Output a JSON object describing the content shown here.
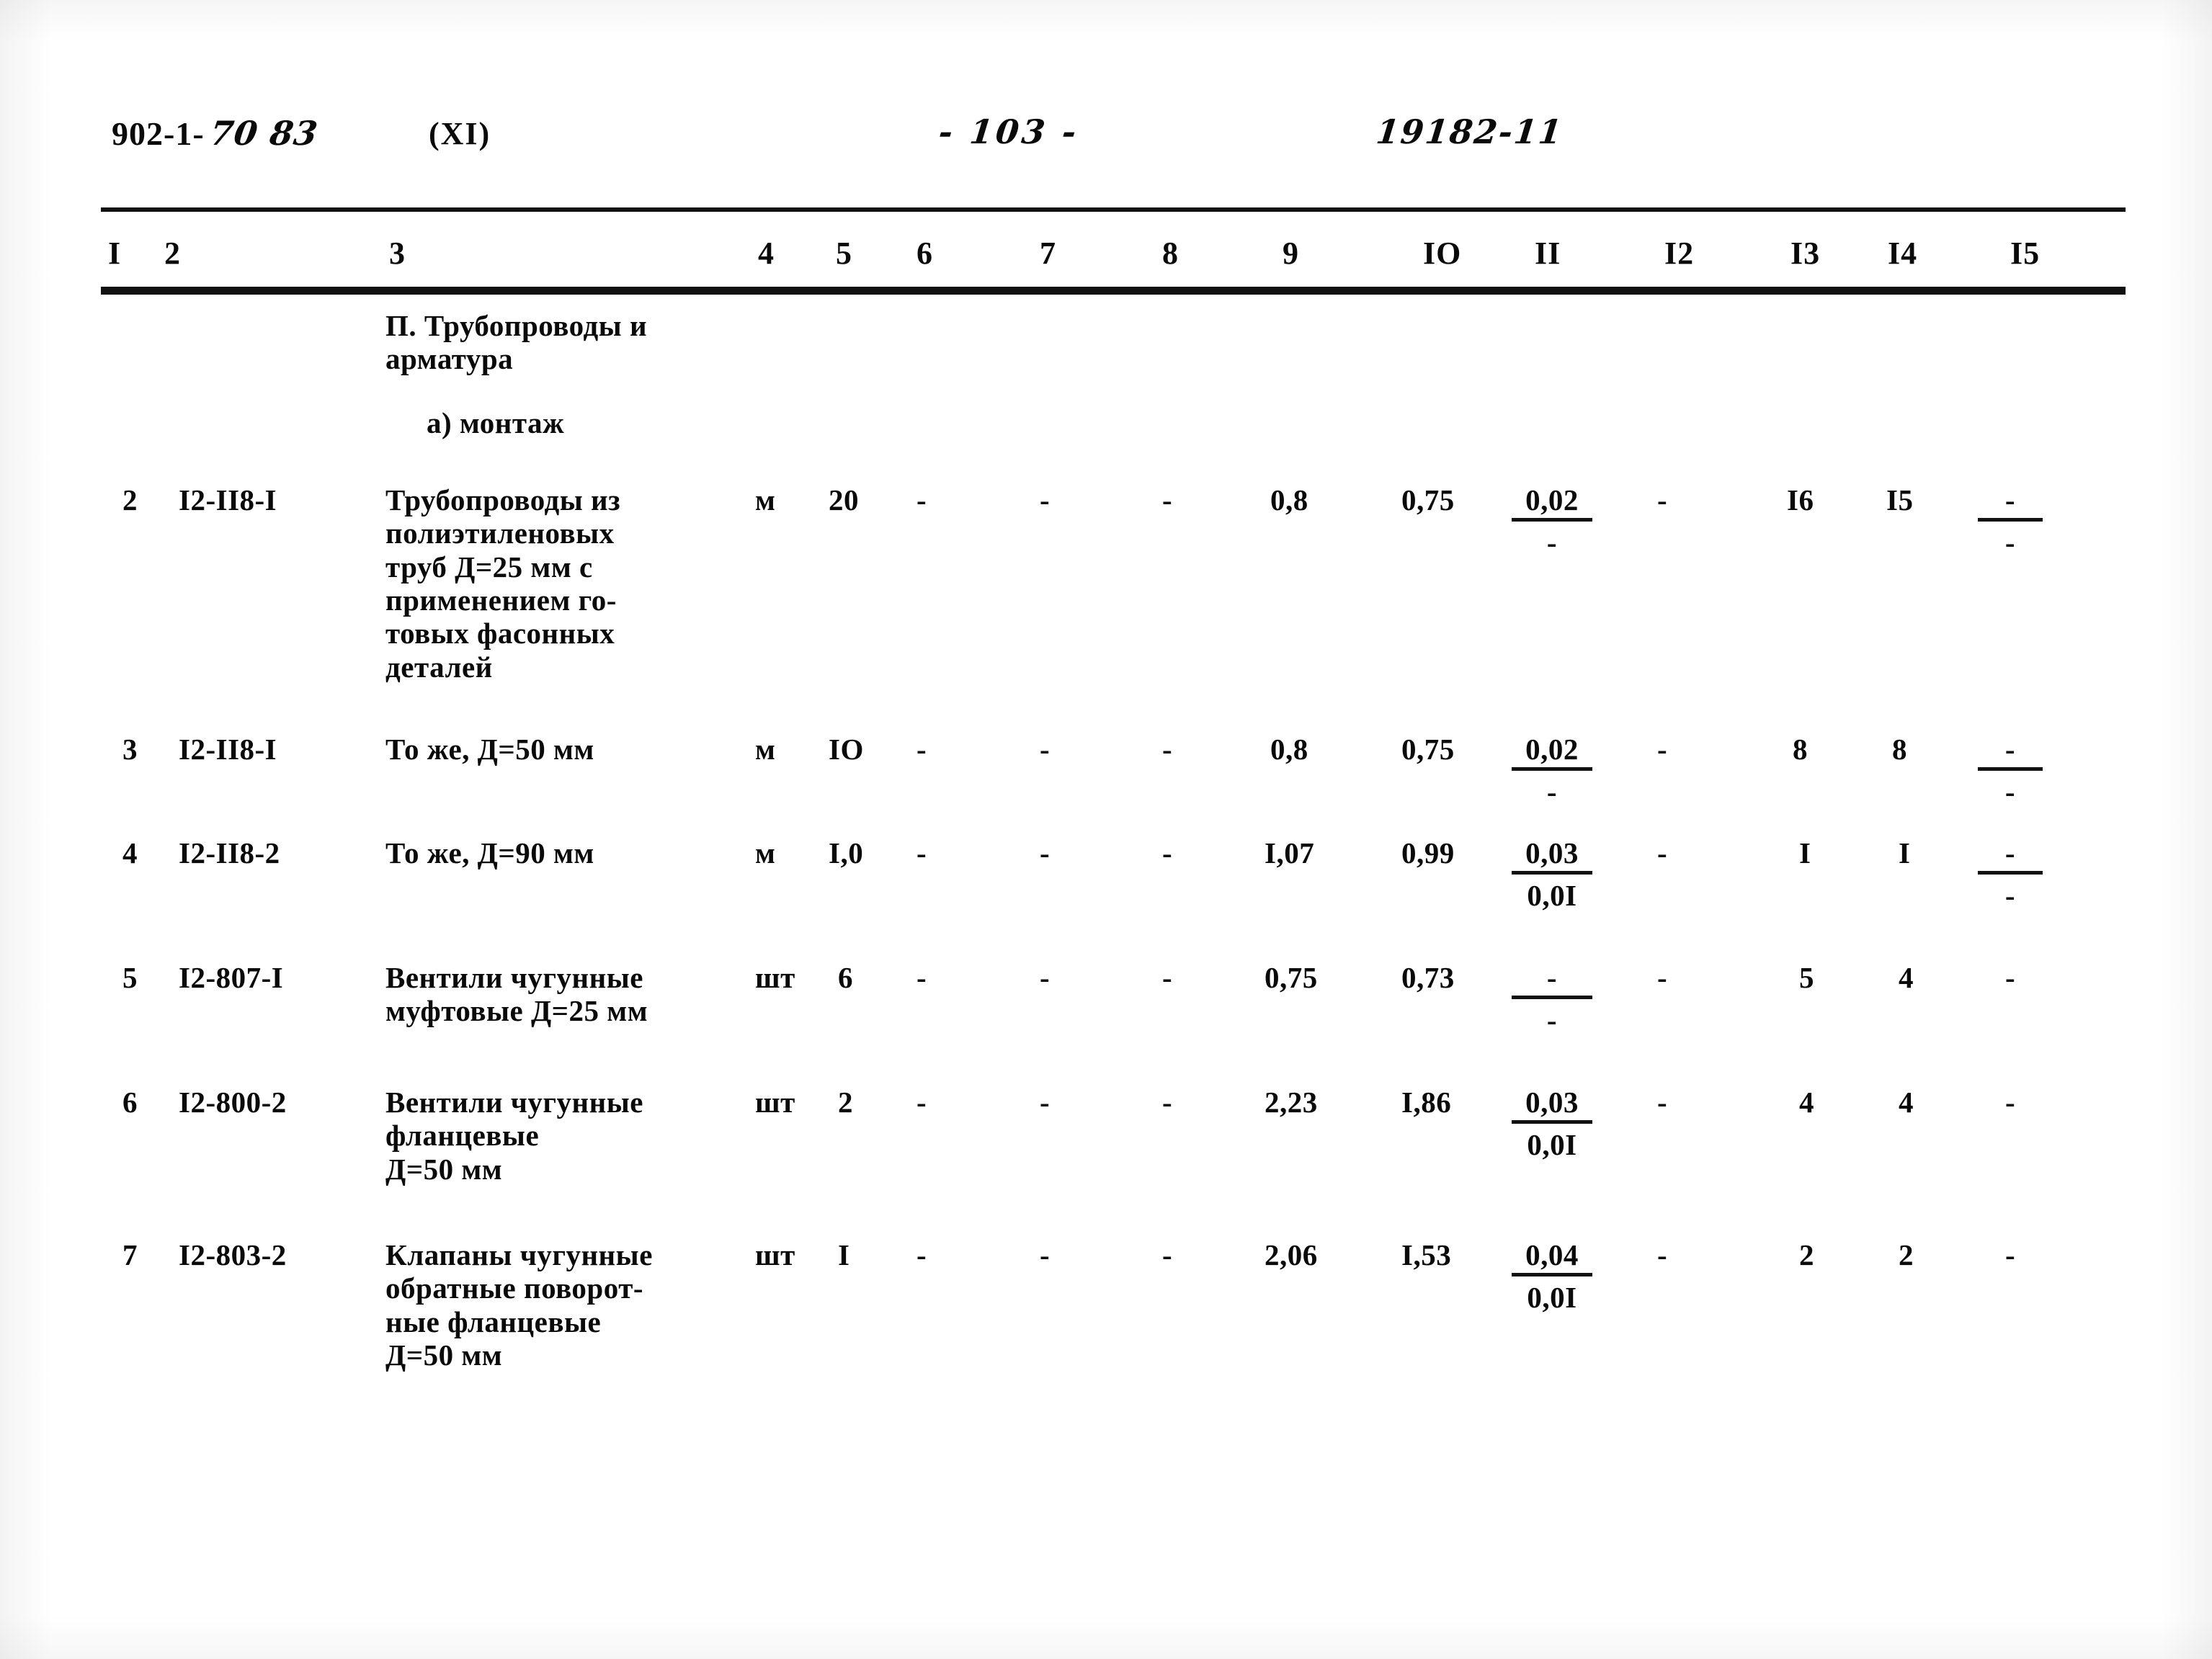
{
  "header": {
    "series_code": "902-1-",
    "series_code_hand": "70 83",
    "volume": "(XI)",
    "page_number": "-  103  -",
    "doc_number": "19182-11"
  },
  "table": {
    "column_numbers": [
      "I",
      "2",
      "3",
      "4",
      "5",
      "6",
      "7",
      "8",
      "9",
      "IO",
      "II",
      "I2",
      "I3",
      "I4",
      "I5"
    ],
    "section_title": "П. Трубопроводы и\nарматура",
    "subsection_title": "а) монтаж",
    "rows": [
      {
        "pos": "2",
        "code": "I2-II8-I",
        "name": "Трубопроводы из\nполиэтиленовых\nтруб Д=25 мм с\nприменением го-\nтовых фасонных\nдеталей",
        "unit": "м",
        "qty": "20",
        "c6": "-",
        "c7": "-",
        "c8": "-",
        "c9": "0,8",
        "c10": "0,75",
        "c11_num": "0,02",
        "c11_den": "-",
        "c12": "-",
        "c13": "I6",
        "c14": "I5",
        "c15_num": "-",
        "c15_den": "-"
      },
      {
        "pos": "3",
        "code": "I2-II8-I",
        "name": "То же, Д=50 мм",
        "unit": "м",
        "qty": "IO",
        "c6": "-",
        "c7": "-",
        "c8": "-",
        "c9": "0,8",
        "c10": "0,75",
        "c11_num": "0,02",
        "c11_den": "-",
        "c12": "-",
        "c13": "8",
        "c14": "8",
        "c15_num": "-",
        "c15_den": "-"
      },
      {
        "pos": "4",
        "code": "I2-II8-2",
        "name": "То же, Д=90 мм",
        "unit": "м",
        "qty": "I,0",
        "c6": "-",
        "c7": "-",
        "c8": "-",
        "c9": "I,07",
        "c10": "0,99",
        "c11_num": "0,03",
        "c11_den": "0,0I",
        "c12": "-",
        "c13": "I",
        "c14": "I",
        "c15_num": "-",
        "c15_den": "-"
      },
      {
        "pos": "5",
        "code": "I2-807-I",
        "name": "Вентили чугунные\nмуфтовые Д=25 мм",
        "unit": "шт",
        "qty": "6",
        "c6": "-",
        "c7": "-",
        "c8": "-",
        "c9": "0,75",
        "c10": "0,73",
        "c11_num": "-",
        "c11_den": "-",
        "c12": "-",
        "c13": "5",
        "c14": "4",
        "c15_num": "-",
        "c15_den": ""
      },
      {
        "pos": "6",
        "code": "I2-800-2",
        "name": "Вентили чугунные\nфланцевые\nД=50 мм",
        "unit": "шт",
        "qty": "2",
        "c6": "-",
        "c7": "-",
        "c8": "-",
        "c9": "2,23",
        "c10": "I,86",
        "c11_num": "0,03",
        "c11_den": "0,0I",
        "c12": "-",
        "c13": "4",
        "c14": "4",
        "c15_num": "-",
        "c15_den": ""
      },
      {
        "pos": "7",
        "code": "I2-803-2",
        "name": "Клапаны чугунные\nобратные поворот-\nные фланцевые\nД=50 мм",
        "unit": "шт",
        "qty": "I",
        "c6": "-",
        "c7": "-",
        "c8": "-",
        "c9": "2,06",
        "c10": "I,53",
        "c11_num": "0,04",
        "c11_den": "0,0I",
        "c12": "-",
        "c13": "2",
        "c14": "2",
        "c15_num": "-",
        "c15_den": ""
      }
    ]
  }
}
